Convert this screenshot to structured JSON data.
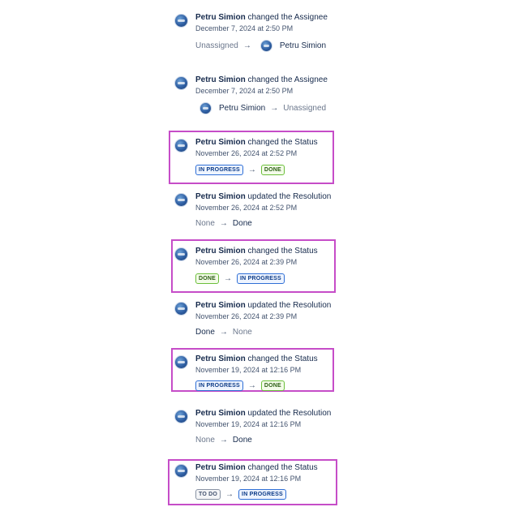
{
  "entries": [
    {
      "actor": "Petru Simion",
      "action": " changed the ",
      "field": "Assignee",
      "timestamp": "December 7, 2024 at 2:50 PM",
      "from": "Unassigned",
      "to": "Petru Simion"
    },
    {
      "actor": "Petru Simion",
      "action": " changed the ",
      "field": "Assignee",
      "timestamp": "December 7, 2024 at 2:50 PM",
      "from": "Petru Simion",
      "to": "Unassigned"
    },
    {
      "actor": "Petru Simion",
      "action": " changed the ",
      "field": "Status",
      "timestamp": "November 26, 2024 at 2:52 PM",
      "from": "IN PROGRESS",
      "to": "DONE"
    },
    {
      "actor": "Petru Simion",
      "action": " updated the ",
      "field": "Resolution",
      "timestamp": "November 26, 2024 at 2:52 PM",
      "from": "None",
      "to": "Done"
    },
    {
      "actor": "Petru Simion",
      "action": " changed the ",
      "field": "Status",
      "timestamp": "November 26, 2024 at 2:39 PM",
      "from": "DONE",
      "to": "IN PROGRESS"
    },
    {
      "actor": "Petru Simion",
      "action": " updated the ",
      "field": "Resolution",
      "timestamp": "November 26, 2024 at 2:39 PM",
      "from": "Done",
      "to": "None"
    },
    {
      "actor": "Petru Simion",
      "action": " changed the ",
      "field": "Status",
      "timestamp": "November 19, 2024 at 12:16 PM",
      "from": "IN PROGRESS",
      "to": "DONE"
    },
    {
      "actor": "Petru Simion",
      "action": " updated the ",
      "field": "Resolution",
      "timestamp": "November 19, 2024 at 12:16 PM",
      "from": "None",
      "to": "Done"
    },
    {
      "actor": "Petru Simion",
      "action": " changed the ",
      "field": "Status",
      "timestamp": "November 19, 2024 at 12:16 PM",
      "from": "TO DO",
      "to": "IN PROGRESS"
    }
  ],
  "arrow_glyph": "→",
  "colors": {
    "highlight_border": "#c64dc8",
    "lozenge_in_progress": "#2f6fd6",
    "lozenge_done": "#6bbf3a",
    "lozenge_to_do": "#8993a4"
  }
}
